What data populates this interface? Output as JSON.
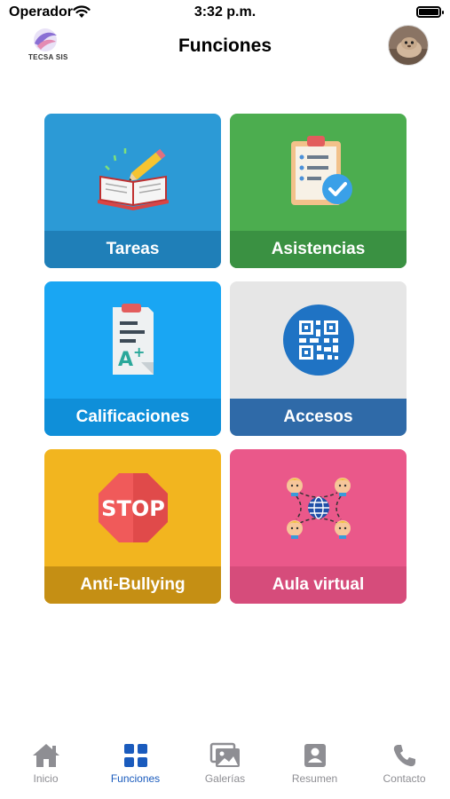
{
  "status_bar": {
    "carrier": "Operador",
    "time": "3:32 p.m."
  },
  "header": {
    "title": "Funciones",
    "logo_text": "TECSA SIS"
  },
  "tiles": [
    {
      "label": "Tareas",
      "icon": "homework-book-pencil-icon"
    },
    {
      "label": "Asistencias",
      "icon": "clipboard-check-icon"
    },
    {
      "label": "Calificaciones",
      "icon": "grade-paper-icon"
    },
    {
      "label": "Accesos",
      "icon": "qr-code-icon"
    },
    {
      "label": "Anti-Bullying",
      "icon": "stop-sign-icon"
    },
    {
      "label": "Aula virtual",
      "icon": "virtual-classroom-globe-icon"
    }
  ],
  "tabs": [
    {
      "label": "Inicio",
      "icon": "home-icon",
      "active": false
    },
    {
      "label": "Funciones",
      "icon": "grid-icon",
      "active": true
    },
    {
      "label": "Galerías",
      "icon": "gallery-icon",
      "active": false
    },
    {
      "label": "Resumen",
      "icon": "profile-card-icon",
      "active": false
    },
    {
      "label": "Contacto",
      "icon": "phone-icon",
      "active": false
    }
  ],
  "colors": {
    "accent": "#1a5bbd",
    "tareas": "#2c9ad6",
    "asistencias": "#4cad4f",
    "calificaciones": "#19a6f3",
    "accesos": "#2f6aa8",
    "anti_bullying": "#f2b51f",
    "aula_virtual": "#ea588a"
  }
}
